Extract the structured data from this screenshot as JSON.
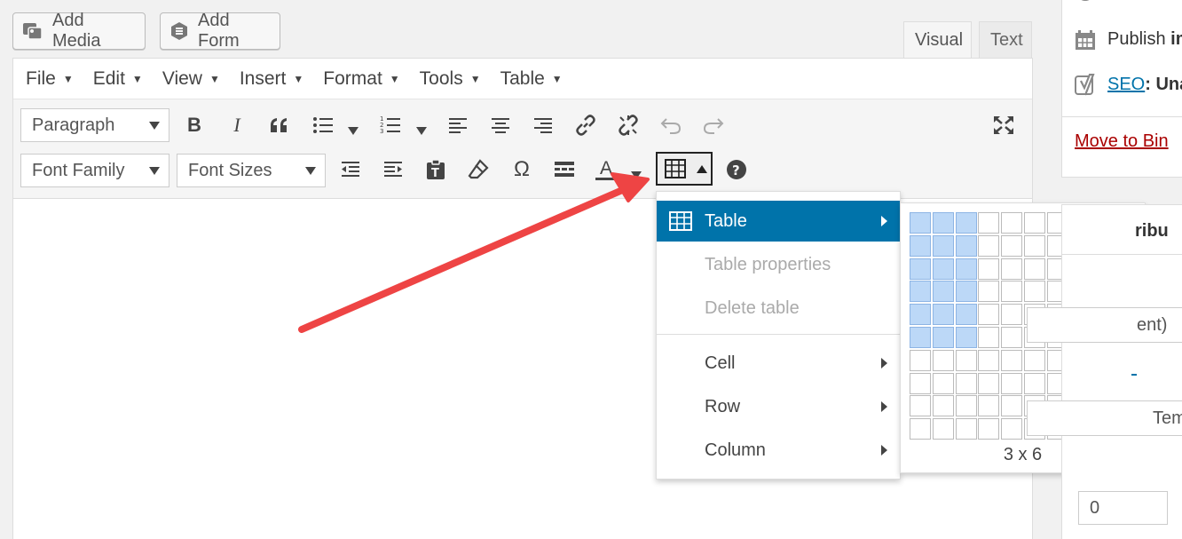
{
  "media_buttons": {
    "add_media": "Add Media",
    "add_form": "Add Form"
  },
  "editor_tabs": {
    "visual": "Visual",
    "text": "Text"
  },
  "menubar": [
    "File",
    "Edit",
    "View",
    "Insert",
    "Format",
    "Tools",
    "Table"
  ],
  "toolbar": {
    "paragraph_select": "Paragraph",
    "font_family_select": "Font Family",
    "font_sizes_select": "Font Sizes",
    "text_color_label": "A",
    "special_char_label": "Ω"
  },
  "table_menu": {
    "items": [
      {
        "label": "Table",
        "state": "active",
        "submenu": true
      },
      {
        "label": "Table properties",
        "state": "disabled",
        "submenu": false
      },
      {
        "label": "Delete table",
        "state": "disabled",
        "submenu": false
      },
      {
        "label": "Cell",
        "state": "normal",
        "submenu": true
      },
      {
        "label": "Row",
        "state": "normal",
        "submenu": true
      },
      {
        "label": "Column",
        "state": "normal",
        "submenu": true
      }
    ]
  },
  "grid_picker": {
    "columns": 10,
    "rows": 10,
    "selected_cols": 3,
    "selected_rows": 6,
    "label": "3 x 6"
  },
  "sidebar": {
    "publish_label": "Publish ",
    "publish_value": "im",
    "seo_link": "SEO",
    "seo_value": ": Unav",
    "move_to_bin": "Move to Bin",
    "attributes_fragment": "ribu",
    "parent_fragment": "ent)",
    "template_fragment": "Tem",
    "order_value": "0"
  },
  "colors": {
    "accent": "#0073aa",
    "arrow": "#ee4444",
    "grid_selected": "#bcd8f7",
    "trash": "#aa0000"
  }
}
